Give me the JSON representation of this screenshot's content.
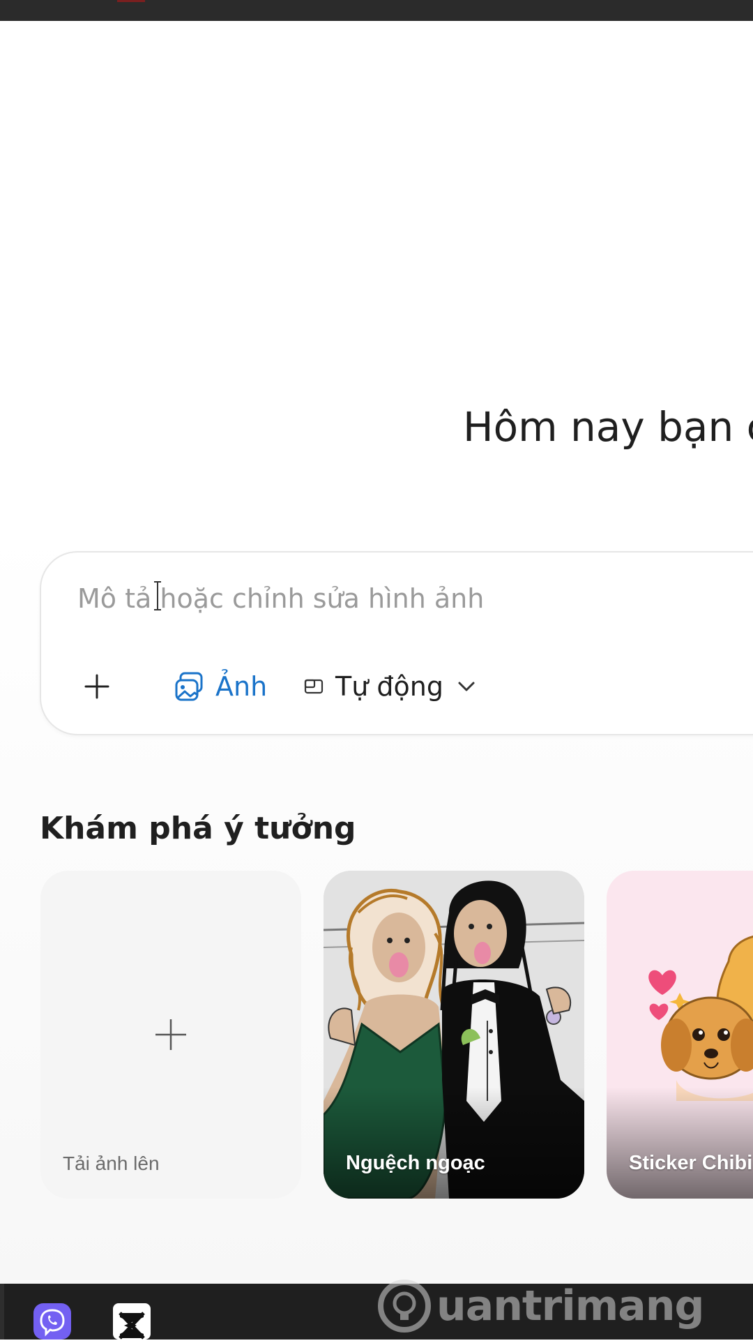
{
  "header": {
    "greeting": "Hôm nay bạn c"
  },
  "composer": {
    "placeholder": "Mô tả hoặc chỉnh sửa hình ảnh",
    "value": "",
    "tools": {
      "add_icon": "plus-icon",
      "photo_label": "Ảnh",
      "photo_icon": "image-icon",
      "aspect_label": "Tự động",
      "aspect_icon": "aspect-ratio-icon"
    },
    "accent_color": "#1a73c9"
  },
  "explore": {
    "title": "Khám phá ý tưởng",
    "cards": [
      {
        "label": "Tải ảnh lên",
        "icon": "plus-icon"
      },
      {
        "label": "Nguệch ngoạc"
      },
      {
        "label": "Sticker Chibi"
      }
    ]
  },
  "taskbar": {
    "apps": [
      {
        "name": "Viber",
        "icon": "viber-icon",
        "color": "#7360f2"
      },
      {
        "name": "CapCut",
        "icon": "capcut-icon",
        "color": "#ffffff"
      }
    ]
  },
  "watermark": {
    "text": "uantrimang"
  }
}
